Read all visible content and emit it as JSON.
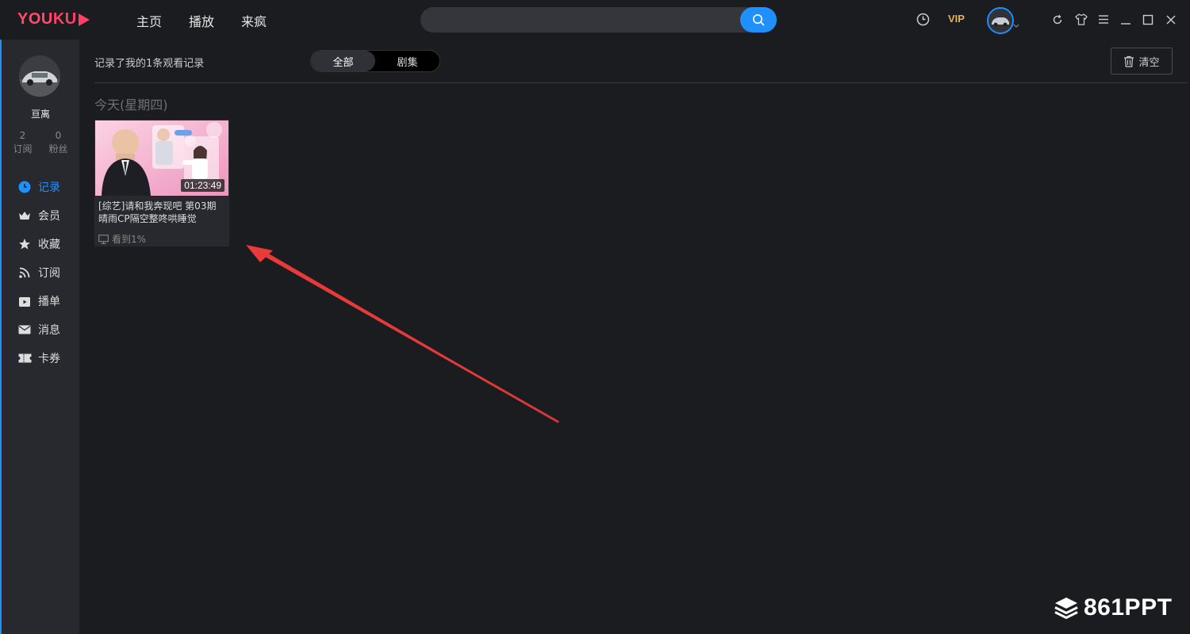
{
  "app": {
    "logo_text_a": "YOU",
    "logo_text_b": "KU"
  },
  "nav": {
    "items": [
      {
        "label": "主页"
      },
      {
        "label": "播放"
      },
      {
        "label": "来疯"
      }
    ]
  },
  "search": {
    "placeholder": ""
  },
  "topbar": {
    "vip_label": "VIP"
  },
  "sidebar": {
    "username": "亘离",
    "stats": [
      {
        "value": "2",
        "label": "订阅"
      },
      {
        "value": "0",
        "label": "粉丝"
      }
    ],
    "items": [
      {
        "label": "记录",
        "icon": "clock-icon",
        "active": true
      },
      {
        "label": "会员",
        "icon": "crown-icon"
      },
      {
        "label": "收藏",
        "icon": "star-icon"
      },
      {
        "label": "订阅",
        "icon": "rss-icon"
      },
      {
        "label": "播单",
        "icon": "playlist-icon"
      },
      {
        "label": "消息",
        "icon": "mail-icon"
      },
      {
        "label": "卡券",
        "icon": "ticket-icon"
      }
    ]
  },
  "main": {
    "summary": "记录了我的1条观看记录",
    "tabs": [
      {
        "label": "全部",
        "selected": true
      },
      {
        "label": "剧集"
      }
    ],
    "clear_label": "清空",
    "day_label": "今天(星期四)",
    "card": {
      "duration": "01:23:49",
      "title_line1": "[综艺]请和我奔现吧 第03期",
      "title_line2": "晴雨CP隔空整咚哄睡觉",
      "progress": "看到1%"
    }
  },
  "watermark": {
    "text": "861PPT"
  },
  "colors": {
    "accent": "#1e90ff",
    "brand": "#ff3f63",
    "vip": "#e2b354",
    "annotation_arrow": "#e83a3a"
  }
}
